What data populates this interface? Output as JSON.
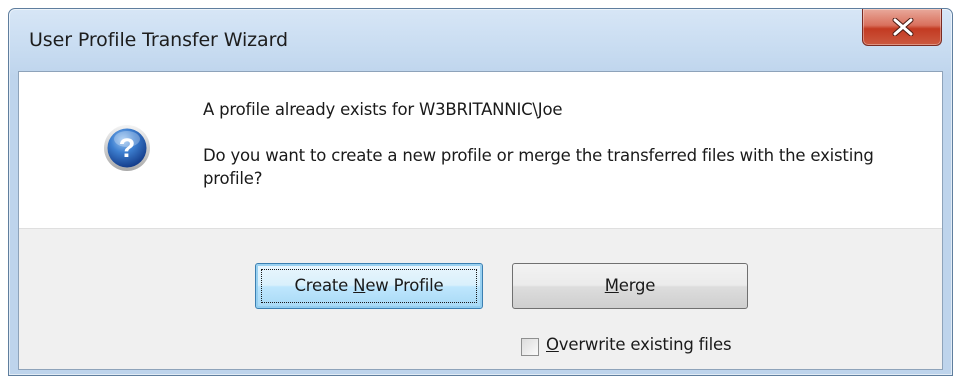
{
  "window": {
    "title": "User Profile Transfer Wizard",
    "close_icon": "close-x-icon"
  },
  "message": {
    "icon": "question-icon",
    "line1": "A profile already exists for W3BRITANNIC\\Joe",
    "line2": "Do you want to create a new profile or merge the transferred files with the existing profile?"
  },
  "buttons": {
    "create": {
      "pre": "Create ",
      "accel": "N",
      "post": "ew Profile"
    },
    "merge": {
      "pre": "",
      "accel": "M",
      "post": "erge"
    }
  },
  "checkbox": {
    "accel": "O",
    "rest": "verwrite existing files",
    "checked": false
  },
  "colors": {
    "close_red": "#c33a22",
    "default_button_border": "#3c7fb1",
    "frame": "#bed4ec"
  }
}
